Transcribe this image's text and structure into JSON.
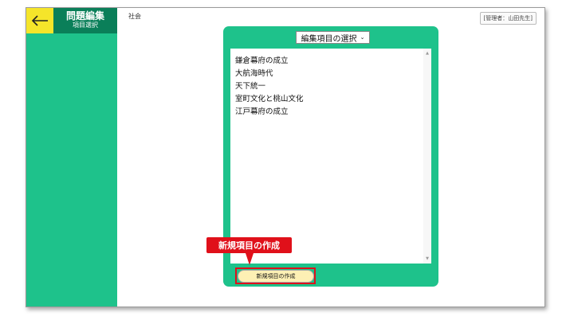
{
  "header": {
    "title": "問題編集",
    "subtitle": "項目選択"
  },
  "subject": "社会",
  "admin": "[管理者：山田先生]",
  "select": {
    "value": "編集項目の選択"
  },
  "list": {
    "items": [
      "鎌倉幕府の成立",
      "大航海時代",
      "天下統一",
      "室町文化と桃山文化",
      "江戸幕府の成立"
    ]
  },
  "create_button": "新規項目の作成",
  "callout": "新規項目の作成",
  "colors": {
    "sidebar": "#1ec28b",
    "header_dark": "#0a7f59",
    "back_button": "#f5e52a",
    "accent_red": "#e0101a",
    "button_fill": "#fdf0b4"
  },
  "icons": {
    "back": "arrow-left-icon",
    "dropdown": "chevron-down-icon"
  }
}
